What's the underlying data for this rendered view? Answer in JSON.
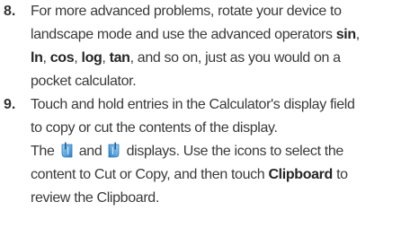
{
  "steps": [
    {
      "number": "8.",
      "lines": {
        "l1": "For more advanced problems, rotate your device to",
        "l2_pre": "landscape mode and use the advanced operators ",
        "l2_sin": "sin",
        "l2_post": ",",
        "l3_ln": "ln",
        "l3_a": ", ",
        "l3_cos": "cos",
        "l3_b": ", ",
        "l3_log": "log",
        "l3_c": ", ",
        "l3_tan": "tan",
        "l3_d": ", and so on, just as you would on a",
        "l4": "pocket calculator."
      }
    },
    {
      "number": "9.",
      "lines": {
        "l1": "Touch and hold entries in the Calculator's display field",
        "l2": "to copy or cut the contents of the display.",
        "l3_a": "The ",
        "l3_b": " and ",
        "l3_c": " displays. Use the icons to select the",
        "l4": "content to Cut or Copy, and then touch ",
        "l4_bold": "Clipboard",
        "l4_post": " to",
        "l5": "review the Clipboard."
      }
    }
  ],
  "icons": {
    "left_handle": "selection-start-handle-icon",
    "right_handle": "selection-end-handle-icon",
    "accent": "#4a9fd8"
  }
}
